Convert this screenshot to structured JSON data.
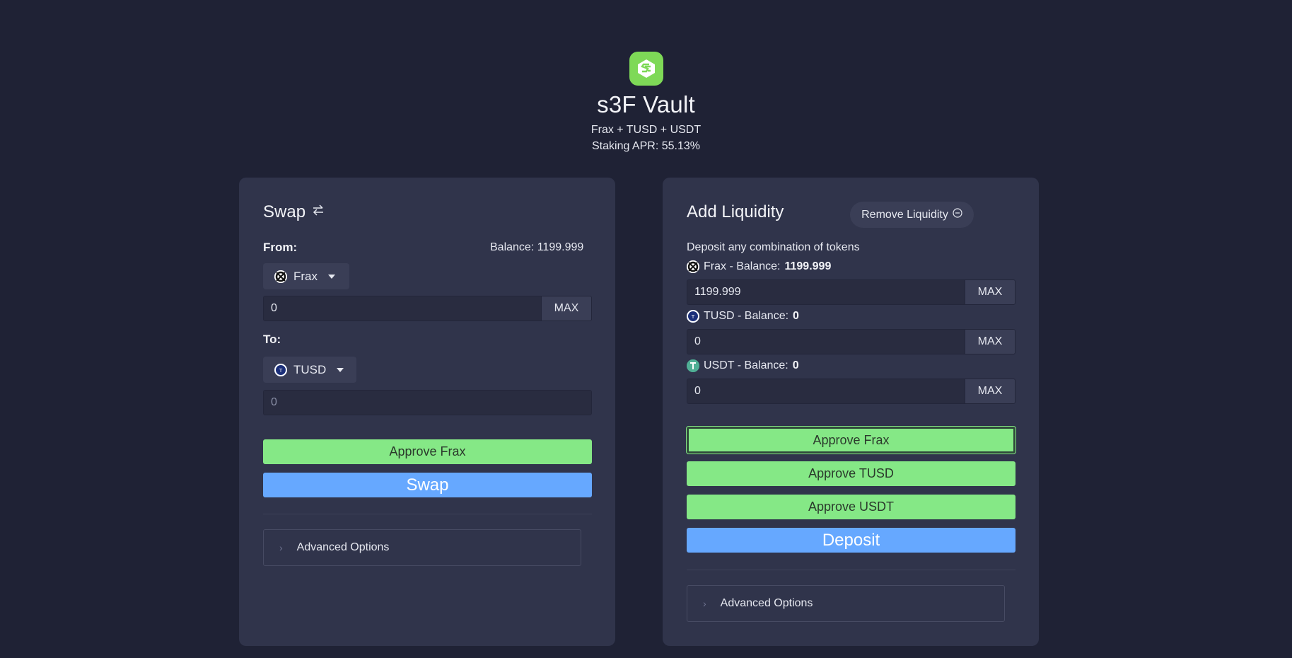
{
  "header": {
    "title": "s3F Vault",
    "subtitle": "Frax + TUSD + USDT",
    "apr": "Staking APR: 55.13%",
    "logo_icon": "saddle-logo-icon",
    "logo_color": "#7ed957"
  },
  "swap": {
    "title": "Swap",
    "title_icon": "swap-arrows-icon",
    "from_label": "From:",
    "balance": "Balance: 1199.999",
    "from_token": "Frax",
    "from_value": "0",
    "max_label": "MAX",
    "to_label": "To:",
    "to_token": "TUSD",
    "to_placeholder": "0",
    "approve_label": "Approve Frax",
    "swap_label": "Swap",
    "advanced_label": "Advanced Options"
  },
  "liquidity": {
    "title": "Add Liquidity",
    "remove_label": "Remove Liquidity",
    "description": "Deposit any combination of tokens",
    "tokens": [
      {
        "name": "Frax",
        "balance_prefix": "Frax - Balance:",
        "balance": "1199.999",
        "value": "1199.999",
        "icon": "frax-icon"
      },
      {
        "name": "TUSD",
        "balance_prefix": "TUSD - Balance:",
        "balance": "0",
        "value": "0",
        "icon": "tusd-icon"
      },
      {
        "name": "USDT",
        "balance_prefix": "USDT - Balance:",
        "balance": "0",
        "value": "0",
        "icon": "usdt-icon"
      }
    ],
    "max_label": "MAX",
    "approve_buttons": [
      "Approve Frax",
      "Approve TUSD",
      "Approve USDT"
    ],
    "deposit_label": "Deposit",
    "advanced_label": "Advanced Options"
  },
  "colors": {
    "background": "#1f2235",
    "card": "#30344b",
    "approve_green": "#85e886",
    "action_blue": "#66a8ff"
  }
}
